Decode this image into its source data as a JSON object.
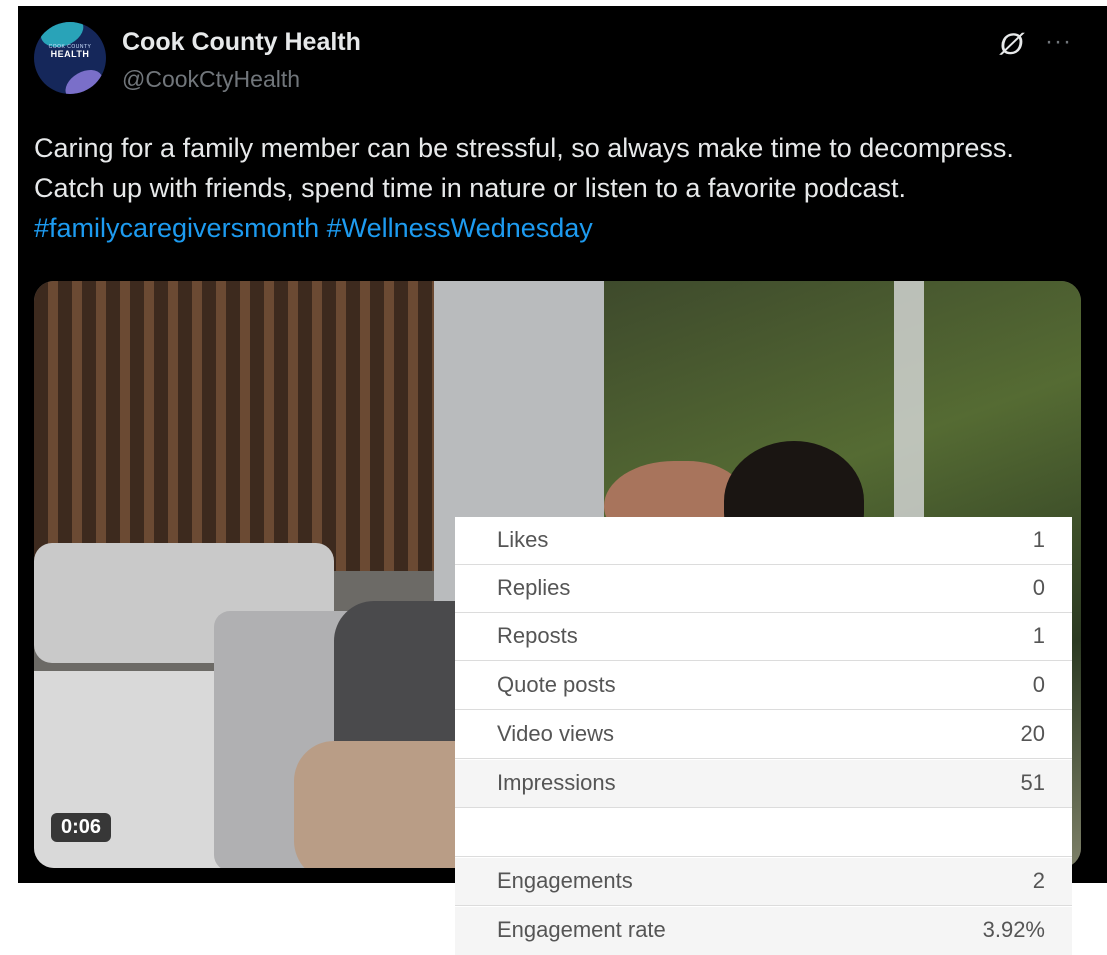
{
  "tweet": {
    "author_name": "Cook County Health",
    "author_handle": "@CookCtyHealth",
    "avatar_text": "HEALTH",
    "avatar_subtext": "COOK COUNTY",
    "icons": [
      "grok-icon",
      "more-icon"
    ],
    "more_glyph": "···",
    "grok_glyph": "Ø",
    "body_text": "Caring for a family member can be stressful, so always make time to decompress. Catch up with friends, spend time in nature or listen to a favorite podcast. ",
    "hashtags": [
      "#familycaregiversmonth",
      "#WellnessWednesday"
    ],
    "video_duration": "0:06"
  },
  "stats": {
    "rows": [
      {
        "label": "Likes",
        "value": "1"
      },
      {
        "label": "Replies",
        "value": "0"
      },
      {
        "label": "Reposts",
        "value": "1"
      },
      {
        "label": "Quote posts",
        "value": "0"
      },
      {
        "label": "Video views",
        "value": "20"
      },
      {
        "label": "Impressions",
        "value": "51"
      },
      {
        "label": "",
        "value": ""
      },
      {
        "label": "Engagements",
        "value": "2"
      },
      {
        "label": "Engagement rate",
        "value": "3.92%"
      }
    ]
  },
  "colors": {
    "background": "#000000",
    "text": "#e7e9ea",
    "muted": "#71767b",
    "link": "#1d9bf0",
    "stats_text": "#555555"
  }
}
